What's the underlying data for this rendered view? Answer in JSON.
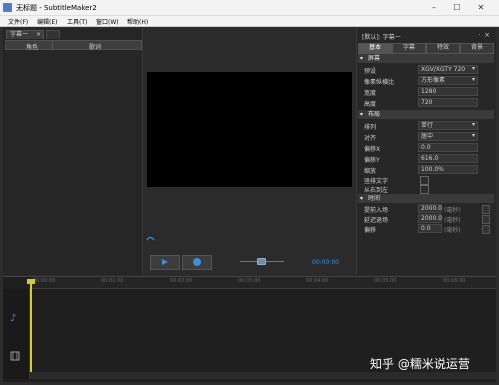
{
  "window": {
    "title": "无标题 - SubtitleMaker2",
    "minimize_icon": "minimize-icon",
    "maximize_icon": "maximize-icon",
    "close_icon": "close-icon"
  },
  "menu": [
    "文件(F)",
    "编辑(E)",
    "工具(T)",
    "窗口(W)",
    "帮助(H)"
  ],
  "left_panel": {
    "tab_label": "字幕一",
    "tab_close": "×",
    "columns": [
      "角色",
      "歌词"
    ]
  },
  "player": {
    "timecode": "00:00:00"
  },
  "right_panel": {
    "title": "[默认]: 字幕一",
    "pin": "ᐧ",
    "close": "×",
    "tabs": [
      "基本",
      "字幕",
      "特效",
      "背景"
    ],
    "sections": {
      "screen": {
        "title": "屏幕",
        "rows": [
          {
            "label": "预设",
            "value": "XGV/XGTY 720",
            "dropdown": true
          },
          {
            "label": "像素纵横比",
            "value": "方形像素",
            "dropdown": true
          },
          {
            "label": "宽度",
            "value": "1280"
          },
          {
            "label": "高度",
            "value": "720"
          }
        ]
      },
      "layout": {
        "title": "布局",
        "rows": [
          {
            "label": "排列",
            "value": "单行",
            "dropdown": true
          },
          {
            "label": "对齐",
            "value": "居中",
            "dropdown": true
          },
          {
            "label": "偏移X",
            "value": "0.0"
          },
          {
            "label": "偏移Y",
            "value": "616.0"
          },
          {
            "label": "缩放",
            "value": "100.0%"
          },
          {
            "label": "竖排文字",
            "checkbox": true
          },
          {
            "label": "从右到左",
            "checkbox": true
          }
        ]
      },
      "timing": {
        "title": "时间",
        "rows": [
          {
            "label": "提前入场",
            "value": "2000.0",
            "unit": "(毫秒)"
          },
          {
            "label": "延迟退场",
            "value": "2000.0",
            "unit": "(毫秒)"
          },
          {
            "label": "偏移",
            "value": "0.0",
            "unit": "(毫秒)"
          }
        ]
      }
    }
  },
  "timeline": {
    "ticks": [
      "00:00:00",
      "00:01:00",
      "00:02:00",
      "00:03:00",
      "00:04:00",
      "00:05:00",
      "00:06:00"
    ]
  },
  "watermark": "知乎 @糯米说运营"
}
